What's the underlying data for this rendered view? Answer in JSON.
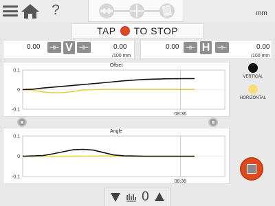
{
  "toolbar": {
    "unit": "mm",
    "steps": [
      "step-setup-icon",
      "step-measure-icon",
      "step-report-icon"
    ]
  },
  "tap_bar": {
    "text_left": "TAP",
    "text_right": "TO STOP"
  },
  "vertical_panel": {
    "left_value": "0.00",
    "axis": "V",
    "right_value": "0.00",
    "unit": "/100 mm"
  },
  "horizontal_panel": {
    "left_value": "0.00",
    "axis": "H",
    "right_value": "0.00",
    "unit": "/100 mm"
  },
  "legend": {
    "vertical": {
      "label": "VERTICAL",
      "color": "#111111"
    },
    "horizontal": {
      "label": "HORIZONTAL",
      "color": "#f2df7a"
    }
  },
  "bottom_bar": {
    "count": "0"
  },
  "chart_data": [
    {
      "type": "line",
      "title": "Offset",
      "ylim": [
        -0.1,
        0.1
      ],
      "y_ticks": [
        "0.1",
        "0",
        "-0.1"
      ],
      "x_tick": "08:36",
      "series": [
        {
          "name": "VERTICAL",
          "color": "#111111",
          "x": [
            0,
            0.05,
            0.1,
            0.2,
            0.3,
            0.4,
            0.5,
            0.6,
            0.7,
            0.8,
            0.85
          ],
          "y": [
            0,
            0.002,
            0.008,
            0.017,
            0.026,
            0.035,
            0.045,
            0.052,
            0.055,
            0.056,
            0.056
          ]
        },
        {
          "name": "HORIZONTAL",
          "color": "#e8d24a",
          "x": [
            0,
            0.05,
            0.1,
            0.15,
            0.2,
            0.25,
            0.3,
            0.35,
            0.4,
            0.5,
            0.6,
            0.7,
            0.85
          ],
          "y": [
            0,
            -0.003,
            -0.012,
            -0.016,
            -0.015,
            -0.01,
            -0.002,
            0,
            0.001,
            0.001,
            0.001,
            0.001,
            0.001
          ]
        }
      ]
    },
    {
      "type": "line",
      "title": "Angle",
      "ylim": [
        -0.1,
        0.1
      ],
      "y_ticks": [
        "0.1",
        "0",
        "-0.1"
      ],
      "x_tick": "08:36",
      "series": [
        {
          "name": "VERTICAL",
          "color": "#111111",
          "x": [
            0,
            0.1,
            0.15,
            0.2,
            0.25,
            0.3,
            0.35,
            0.4,
            0.45,
            0.5,
            0.55,
            0.6,
            0.85
          ],
          "y": [
            0,
            0.003,
            0.012,
            0.022,
            0.032,
            0.034,
            0.03,
            0.018,
            0.006,
            0.002,
            0.001,
            0,
            0
          ]
        },
        {
          "name": "HORIZONTAL",
          "color": "#e8d24a",
          "x": [
            0,
            0.2,
            0.4,
            0.5,
            0.6,
            0.85
          ],
          "y": [
            0,
            0,
            0.001,
            0,
            0,
            0
          ]
        }
      ]
    }
  ]
}
